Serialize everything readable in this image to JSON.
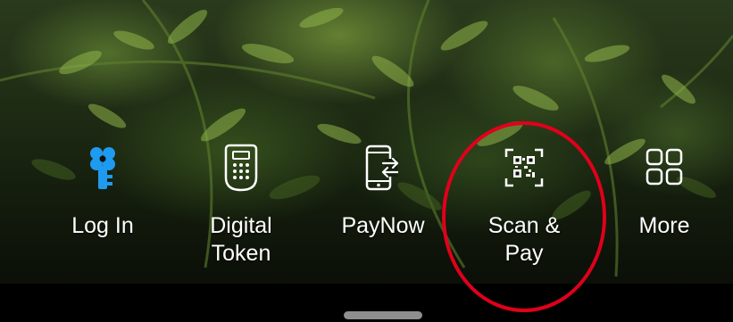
{
  "dock": {
    "items": [
      {
        "label": "Log In",
        "icon": "key-icon"
      },
      {
        "label": "Digital\nToken",
        "icon": "token-device-icon"
      },
      {
        "label": "PayNow",
        "icon": "phone-transfer-icon"
      },
      {
        "label": "Scan & Pay",
        "icon": "qr-scan-icon"
      },
      {
        "label": "More",
        "icon": "grid-icon"
      }
    ]
  },
  "colors": {
    "accent": "#1e9bf0",
    "annotation": "#e0001b",
    "text": "#ffffff"
  }
}
